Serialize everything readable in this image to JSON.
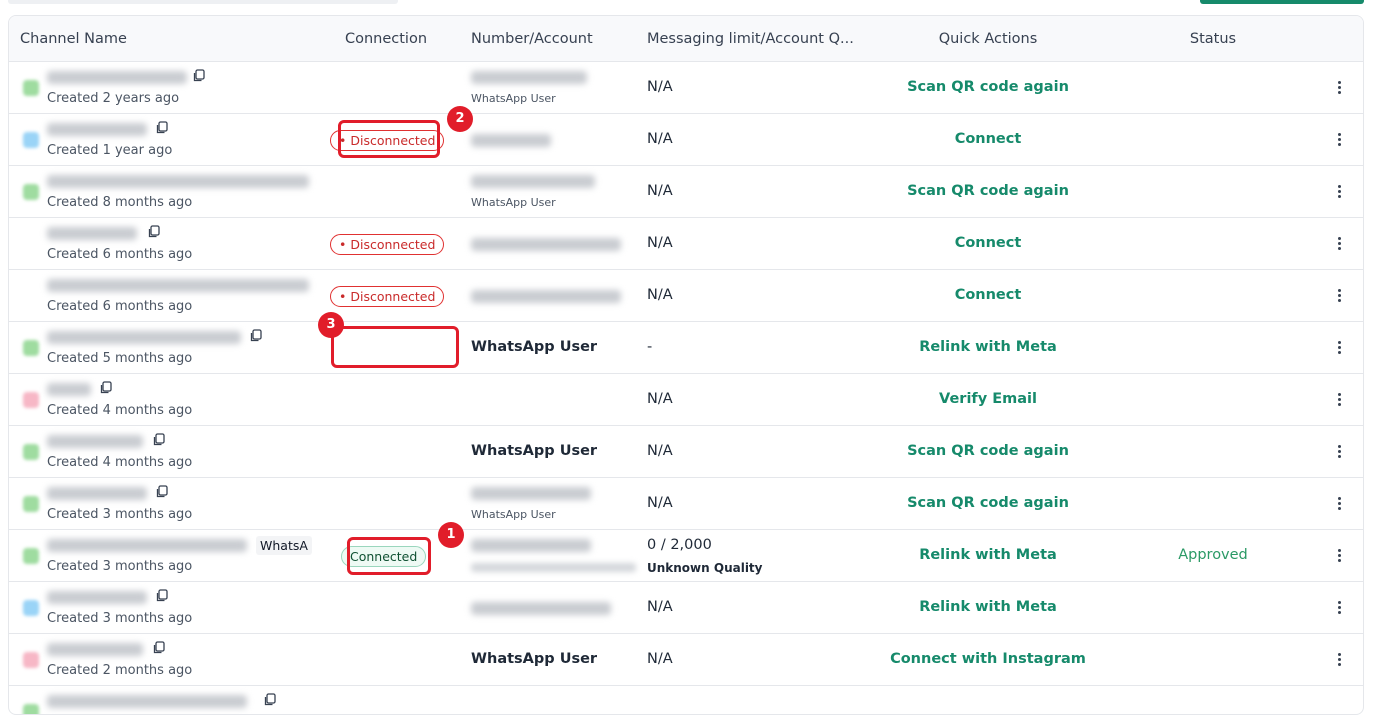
{
  "headers": {
    "channel_name": "Channel Name",
    "connection": "Connection",
    "number_account": "Number/Account",
    "messaging_limit": "Messaging limit/Account Q...",
    "quick_actions": "Quick Actions",
    "status": "Status"
  },
  "rows": [
    {
      "icon": "green",
      "created": "Created 2 years ago",
      "connection": "",
      "number_sub": "WhatsApp User",
      "limit": "N/A",
      "action": "Scan QR code again",
      "status": ""
    },
    {
      "icon": "blue",
      "created": "Created 1 year ago",
      "connection": "Disconnected",
      "number_sub": "",
      "limit": "N/A",
      "action": "Connect",
      "status": ""
    },
    {
      "icon": "green",
      "created": "Created 8 months ago",
      "connection": "",
      "number_sub": "WhatsApp User",
      "limit": "N/A",
      "action": "Scan QR code again",
      "status": ""
    },
    {
      "icon": "none",
      "created": "Created 6 months ago",
      "connection": "Disconnected",
      "number_sub": "",
      "limit": "N/A",
      "action": "Connect",
      "status": ""
    },
    {
      "icon": "none",
      "created": "Created 6 months ago",
      "connection": "Disconnected",
      "number_sub": "",
      "limit": "N/A",
      "action": "Connect",
      "status": ""
    },
    {
      "icon": "green",
      "created": "Created 5 months ago",
      "connection": "",
      "number_bold": "WhatsApp User",
      "limit": "-",
      "action": "Relink with Meta",
      "status": ""
    },
    {
      "icon": "pink",
      "created": "Created 4 months ago",
      "connection": "",
      "limit": "N/A",
      "action": "Verify Email",
      "status": ""
    },
    {
      "icon": "green",
      "created": "Created 4 months ago",
      "connection": "",
      "number_bold": "WhatsApp User",
      "limit": "N/A",
      "action": "Scan QR code again",
      "status": ""
    },
    {
      "icon": "green",
      "created": "Created 3 months ago",
      "connection": "",
      "number_sub": "WhatsApp User",
      "limit": "N/A",
      "action": "Scan QR code again",
      "status": ""
    },
    {
      "icon": "green",
      "created": "Created 3 months ago",
      "tag": "WhatsA",
      "connection": "Connected",
      "limit": "0 / 2,000",
      "quality": "Unknown Quality",
      "action": "Relink with Meta",
      "status": "Approved"
    },
    {
      "icon": "blue",
      "created": "Created 3 months ago",
      "connection": "",
      "limit": "N/A",
      "action": "Relink with Meta",
      "status": ""
    },
    {
      "icon": "pink",
      "created": "Created 2 months ago",
      "connection": "",
      "number_bold": "WhatsApp User",
      "limit": "N/A",
      "action": "Connect with Instagram",
      "status": ""
    }
  ],
  "annotations": {
    "marker_1": "1",
    "marker_2": "2",
    "marker_3": "3"
  },
  "colors": {
    "accent": "#168a6b",
    "disconnected": "#c92a2a",
    "connected": "#0f5132",
    "highlight": "#e11d2a",
    "approved": "#2b9a66"
  }
}
